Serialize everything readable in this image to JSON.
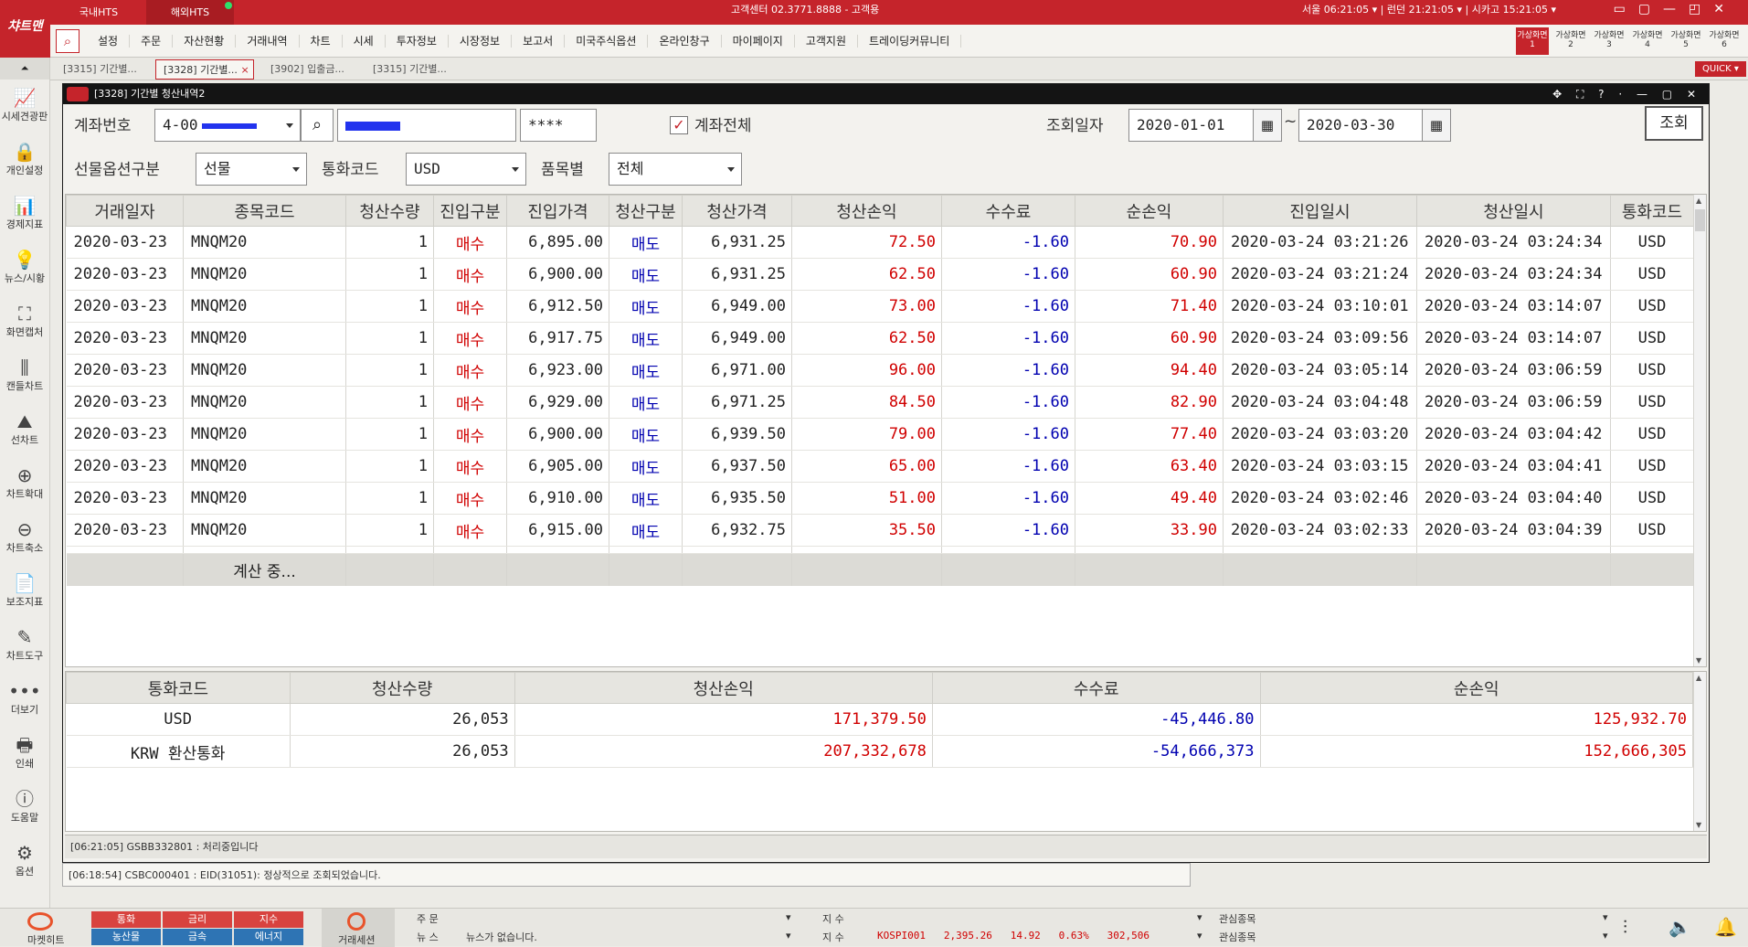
{
  "topbar": {
    "tab_domestic": "국내HTS",
    "tab_overseas": "해외HTS",
    "center_info": "고객센터 02.3771.8888 - 고객용",
    "time_seoul": "서울 06:21:05",
    "time_london": "런던 21:21:05",
    "time_chicago": "시카고 15:21:05"
  },
  "menu": {
    "items": [
      "설정",
      "주문",
      "자산현황",
      "거래내역",
      "차트",
      "시세",
      "투자정보",
      "시장정보",
      "보고서",
      "미국주식옵션",
      "온라인창구",
      "마이페이지",
      "고객지원",
      "트레이딩커뮤니티"
    ],
    "vtabs": [
      "가상화면1",
      "가상화면2",
      "가상화면3",
      "가상화면4",
      "가상화면5",
      "가상화면6"
    ]
  },
  "sidebar": {
    "logo": "챠트맨",
    "collapse": "⏶",
    "items": [
      {
        "icon": "📈",
        "label": "시세견광판"
      },
      {
        "icon": "🔒",
        "label": "개인설정"
      },
      {
        "icon": "📊",
        "label": "경제지표"
      },
      {
        "icon": "💡",
        "label": "뉴스/시황"
      },
      {
        "icon": "⛶",
        "label": "화면캡처"
      },
      {
        "icon": "⫼",
        "label": "캔들차트"
      },
      {
        "icon": "⛰",
        "label": "선차트"
      },
      {
        "icon": "⊕",
        "label": "차트확대"
      },
      {
        "icon": "⊖",
        "label": "차트축소"
      },
      {
        "icon": "📄",
        "label": "보조지표"
      },
      {
        "icon": "✎",
        "label": "차트도구"
      },
      {
        "icon": "•••",
        "label": "더보기"
      },
      {
        "icon": "🖶",
        "label": "인쇄"
      },
      {
        "icon": "ⓘ",
        "label": "도움말"
      },
      {
        "icon": "⚙",
        "label": "옵션"
      }
    ]
  },
  "doctabs": [
    "[3315] 기간별...",
    "[3328] 기간별...",
    "[3902] 입출금...",
    "[3315] 기간별..."
  ],
  "quick": "QUICK ▾",
  "window": {
    "title": "[3328] 기간별 청산내역2",
    "controls": "✥ ⛶ ? · — ▢ ✕"
  },
  "form": {
    "account_label": "계좌번호",
    "account_value": "4-00",
    "password_mask": "****",
    "all_accounts_label": "계좌전체",
    "date_label": "조회일자",
    "date_from": "2020-01-01",
    "date_sep": "~",
    "date_to": "2020-03-30",
    "query_button": "조회",
    "futopt_label": "선물옵션구분",
    "futopt_value": "선물",
    "currency_label": "통화코드",
    "currency_value": "USD",
    "product_label": "품목별",
    "product_value": "전체"
  },
  "main_table": {
    "headers": [
      "거래일자",
      "종목코드",
      "청산수량",
      "진입구분",
      "진입가격",
      "청산구분",
      "청산가격",
      "청산손익",
      "수수료",
      "순손익",
      "진입일시",
      "청산일시",
      "통화코드"
    ],
    "rows": [
      [
        "2020-03-23",
        "MNQM20",
        "1",
        "매수",
        "6,895.00",
        "매도",
        "6,931.25",
        "72.50",
        "-1.60",
        "70.90",
        "2020-03-24 03:21:26",
        "2020-03-24 03:24:34",
        "USD"
      ],
      [
        "2020-03-23",
        "MNQM20",
        "1",
        "매수",
        "6,900.00",
        "매도",
        "6,931.25",
        "62.50",
        "-1.60",
        "60.90",
        "2020-03-24 03:21:24",
        "2020-03-24 03:24:34",
        "USD"
      ],
      [
        "2020-03-23",
        "MNQM20",
        "1",
        "매수",
        "6,912.50",
        "매도",
        "6,949.00",
        "73.00",
        "-1.60",
        "71.40",
        "2020-03-24 03:10:01",
        "2020-03-24 03:14:07",
        "USD"
      ],
      [
        "2020-03-23",
        "MNQM20",
        "1",
        "매수",
        "6,917.75",
        "매도",
        "6,949.00",
        "62.50",
        "-1.60",
        "60.90",
        "2020-03-24 03:09:56",
        "2020-03-24 03:14:07",
        "USD"
      ],
      [
        "2020-03-23",
        "MNQM20",
        "1",
        "매수",
        "6,923.00",
        "매도",
        "6,971.00",
        "96.00",
        "-1.60",
        "94.40",
        "2020-03-24 03:05:14",
        "2020-03-24 03:06:59",
        "USD"
      ],
      [
        "2020-03-23",
        "MNQM20",
        "1",
        "매수",
        "6,929.00",
        "매도",
        "6,971.25",
        "84.50",
        "-1.60",
        "82.90",
        "2020-03-24 03:04:48",
        "2020-03-24 03:06:59",
        "USD"
      ],
      [
        "2020-03-23",
        "MNQM20",
        "1",
        "매수",
        "6,900.00",
        "매도",
        "6,939.50",
        "79.00",
        "-1.60",
        "77.40",
        "2020-03-24 03:03:20",
        "2020-03-24 03:04:42",
        "USD"
      ],
      [
        "2020-03-23",
        "MNQM20",
        "1",
        "매수",
        "6,905.00",
        "매도",
        "6,937.50",
        "65.00",
        "-1.60",
        "63.40",
        "2020-03-24 03:03:15",
        "2020-03-24 03:04:41",
        "USD"
      ],
      [
        "2020-03-23",
        "MNQM20",
        "1",
        "매수",
        "6,910.00",
        "매도",
        "6,935.50",
        "51.00",
        "-1.60",
        "49.40",
        "2020-03-24 03:02:46",
        "2020-03-24 03:04:40",
        "USD"
      ],
      [
        "2020-03-23",
        "MNQM20",
        "1",
        "매수",
        "6,915.00",
        "매도",
        "6,932.75",
        "35.50",
        "-1.60",
        "33.90",
        "2020-03-24 03:02:33",
        "2020-03-24 03:04:39",
        "USD"
      ]
    ],
    "calc_text": "계산 중..."
  },
  "summary_table": {
    "headers": [
      "통화코드",
      "청산수량",
      "청산손익",
      "수수료",
      "순손익"
    ],
    "rows": [
      [
        "USD",
        "26,053",
        "171,379.50",
        "-45,446.80",
        "125,932.70"
      ],
      [
        "KRW 환산통화",
        "26,053",
        "207,332,678",
        "-54,666,373",
        "152,666,305"
      ]
    ]
  },
  "status": {
    "line1": "[06:21:05] GSBB332801 : 처리중입니다",
    "line2": "[06:18:54] CSBC000401 : EID(31051): 정상적으로 조회되었습니다."
  },
  "bottom": {
    "market_heat": "마켓히트",
    "categories": [
      "통화",
      "금리",
      "지수",
      "농산물",
      "금속",
      "에너지"
    ],
    "trade_session": "거래세션",
    "order_label": "주 문",
    "news_label": "뉴 스",
    "news_text": "뉴스가 없습니다.",
    "index_label": "지 수",
    "index_line": "KOSPI001   2,395.26   14.92   0.63%   302,506",
    "watch_label": "관심종목"
  }
}
